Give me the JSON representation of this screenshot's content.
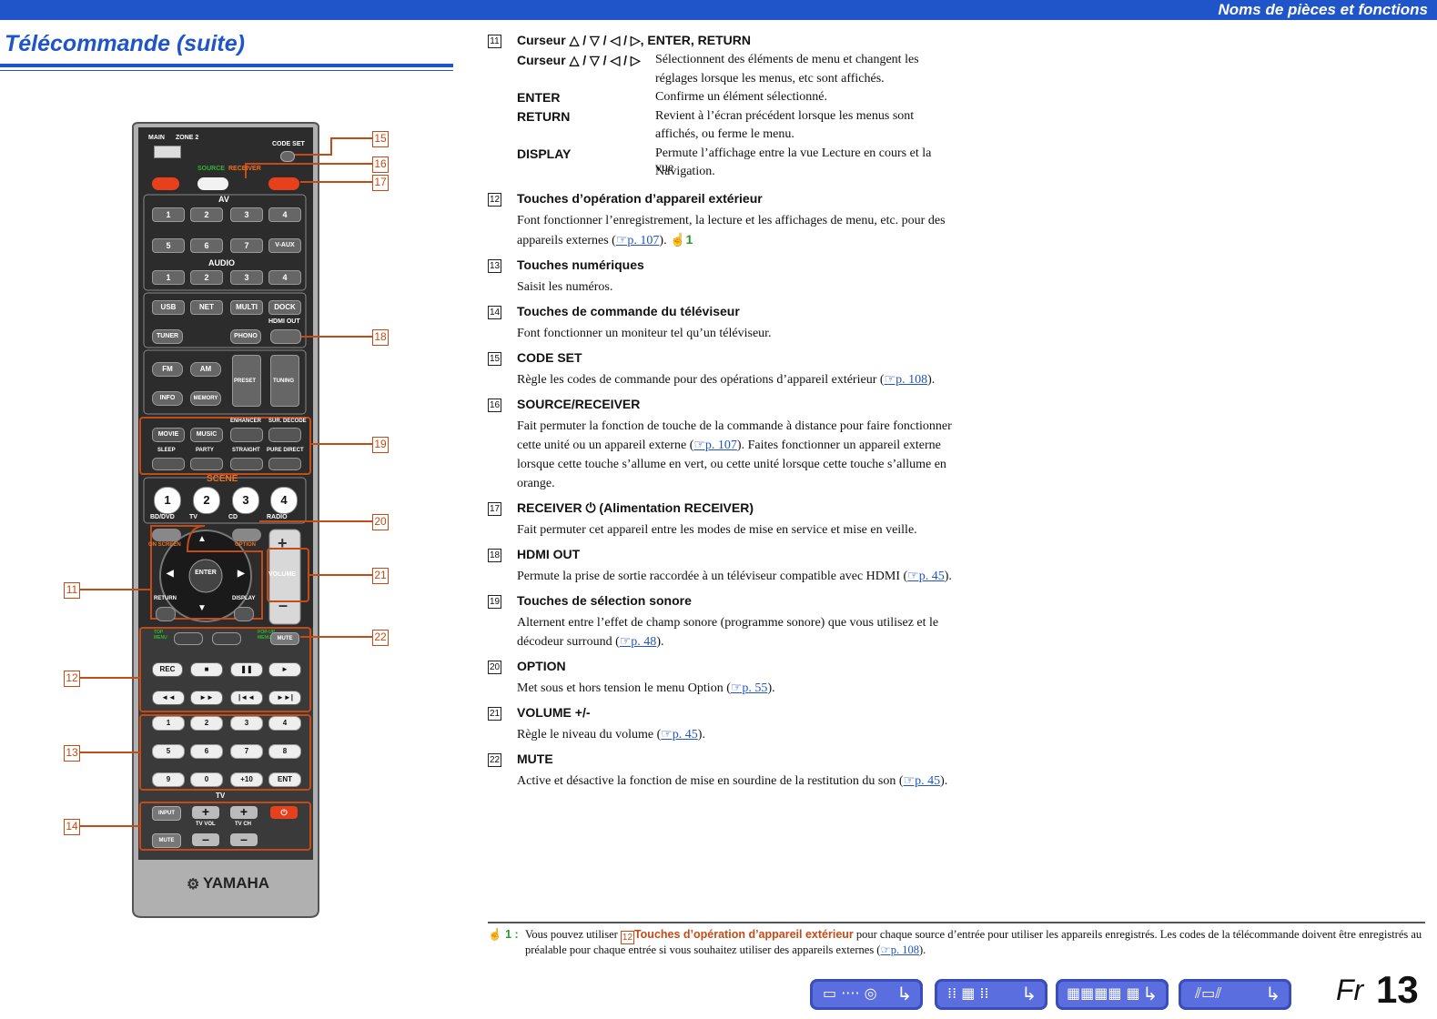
{
  "header": {
    "section": "Noms de pièces et fonctions"
  },
  "page_title": "Télécommande (suite)",
  "remote": {
    "switch_main": "MAIN",
    "switch_zone": "ZONE 2",
    "code_set": "CODE SET",
    "source": "SOURCE",
    "receiver": "RECEIVER",
    "av_label": "AV",
    "av_buttons": [
      "1",
      "2",
      "3",
      "4",
      "5",
      "6",
      "7",
      "V-AUX"
    ],
    "audio_label": "AUDIO",
    "audio_buttons": [
      "1",
      "2",
      "3",
      "4"
    ],
    "input_row": [
      "USB",
      "NET",
      "MULTI",
      "DOCK"
    ],
    "hdmi_out": "HDMI OUT",
    "tuner": "TUNER",
    "phono": "PHONO",
    "fm": "FM",
    "am": "AM",
    "info": "INFO",
    "memory": "MEMORY",
    "preset": "PRESET",
    "tuning": "TUNING",
    "enhancer": "ENHANCER",
    "sur_decode": "SUR. DECODE",
    "movie": "MOVIE",
    "music": "MUSIC",
    "sleep": "SLEEP",
    "party": "PARTY",
    "straight": "STRAIGHT",
    "pure_direct": "PURE DIRECT",
    "scene_label": "SCENE",
    "scene_numbers": [
      "1",
      "2",
      "3",
      "4"
    ],
    "scene_names": [
      "BD/DVD",
      "TV",
      "CD",
      "RADIO"
    ],
    "on_screen": "ON SCREEN",
    "option": "OPTION",
    "enter": "ENTER",
    "return": "RETURN",
    "display": "DISPLAY",
    "volume": "VOLUME",
    "top_menu": "TOP MENU",
    "popup_menu": "POP-UP MENU",
    "mute": "MUTE",
    "rec": "REC",
    "numpad": [
      "1",
      "2",
      "3",
      "4",
      "5",
      "6",
      "7",
      "8",
      "9",
      "0",
      "+10",
      "ENT"
    ],
    "tv_label": "TV",
    "tv_input": "INPUT",
    "tv_mute": "MUTE",
    "tv_vol": "TV VOL",
    "tv_ch": "TV CH",
    "brand": "YAMAHA",
    "callouts": [
      "15",
      "16",
      "17",
      "18",
      "19",
      "20",
      "21",
      "22",
      "11",
      "12",
      "13",
      "14"
    ]
  },
  "items": {
    "i11": {
      "num": "11",
      "title": "Curseur △ / ▽ / ◁ / ▷, ENTER, RETURN",
      "subs": [
        {
          "key": "Curseur △ / ▽ / ◁ / ▷",
          "l1": "Sélectionnent des éléments de menu et changent les",
          "l2": "réglages lorsque les menus, etc sont affichés."
        },
        {
          "key": "ENTER",
          "l1": "Confirme un élément sélectionné."
        },
        {
          "key": "RETURN",
          "l1": "Revient à l’écran précédent lorsque les menus sont",
          "l2": "affichés, ou ferme le menu."
        },
        {
          "key": "DISPLAY",
          "l1": "Permute l’affichage entre la vue Lecture en cours et la vue",
          "l2": "Navigation."
        }
      ]
    },
    "i12": {
      "num": "12",
      "title": "Touches d’opération d’appareil extérieur",
      "body": "Font fonctionner l’enregistrement, la lecture et les affichages de menu, etc. pour des appareils externes (",
      "ref": "☞p. 107",
      "tail": ").",
      "tip": "1"
    },
    "i13": {
      "num": "13",
      "title": "Touches numériques",
      "body": "Saisit les numéros."
    },
    "i14": {
      "num": "14",
      "title": "Touches de commande du téléviseur",
      "body": "Font fonctionner un moniteur tel qu’un téléviseur."
    },
    "i15": {
      "num": "15",
      "title": "CODE SET",
      "body": "Règle les codes de commande pour des opérations d’appareil extérieur (",
      "ref": "☞p. 108",
      "tail": ")."
    },
    "i16": {
      "num": "16",
      "title": "SOURCE/RECEIVER",
      "body": "Fait permuter la fonction de touche de la commande à distance pour faire fonctionner cette unité ou un appareil externe (",
      "ref": "☞p. 107",
      "tail": "). Faites fonctionner un appareil externe lorsque cette touche s’allume en vert, ou cette unité lorsque cette touche s’allume en orange."
    },
    "i17": {
      "num": "17",
      "title": "RECEIVER ⏻ (Alimentation RECEIVER)",
      "body": "Fait permuter cet appareil entre les modes de mise en service et mise en veille."
    },
    "i18": {
      "num": "18",
      "title": "HDMI OUT",
      "body": "Permute la prise de sortie raccordée à un téléviseur compatible avec HDMI (",
      "ref": "☞p. 45",
      "tail": ")."
    },
    "i19": {
      "num": "19",
      "title": "Touches de sélection sonore",
      "body": "Alternent entre l’effet de champ sonore (programme sonore) que vous utilisez et le décodeur surround (",
      "ref": "☞p. 48",
      "tail": ")."
    },
    "i20": {
      "num": "20",
      "title": "OPTION",
      "body": "Met sous et hors tension le menu Option (",
      "ref": "☞p. 55",
      "tail": ")."
    },
    "i21": {
      "num": "21",
      "title": "VOLUME +/-",
      "body": "Règle le niveau du volume (",
      "ref": "☞p. 45",
      "tail": ")."
    },
    "i22": {
      "num": "22",
      "title": "MUTE",
      "body": "Active et désactive la fonction de mise en sourdine de la restitution du son (",
      "ref": "☞p. 45",
      "tail": ")."
    }
  },
  "note": {
    "label": "1 :",
    "pre": "Vous pouvez utiliser ",
    "ref_num": "12",
    "ref_title": "Touches d’opération d’appareil extérieur",
    "post": " pour chaque source d’entrée pour utiliser les appareils enregistrés. Les codes de la télécommande doivent être enregistrés au préalable pour chaque entrée si vous souhaitez utiliser des appareils externes (",
    "ref": "☞p. 108",
    "tail": ")."
  },
  "footer": {
    "nav_icons": [
      "front-panel-icon",
      "rear-panel-icon",
      "display-icon",
      "remote-icon"
    ],
    "lang": "Fr",
    "page": "13"
  },
  "colors": {
    "accent": "#1f55c8",
    "callout": "#c64a16",
    "tip": "#2a9a2a",
    "power": "#e8401c"
  }
}
